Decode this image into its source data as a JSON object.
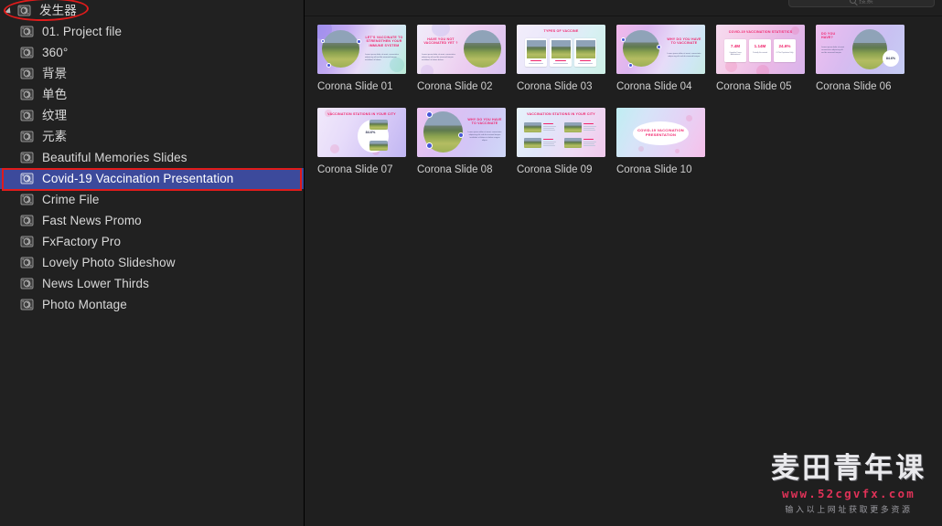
{
  "window": {
    "background": "#1f1f1f",
    "sidebar_background": "#212121",
    "selection_color": "#3c4a9c",
    "annotation_color": "#e01b1b"
  },
  "sidebar": {
    "group": {
      "label": "发生器",
      "icon": "generator-icon",
      "expanded": true
    },
    "items": [
      {
        "label": "01. Project file",
        "icon": "generator-icon",
        "selected": false
      },
      {
        "label": "360°",
        "icon": "generator-icon",
        "selected": false
      },
      {
        "label": "背景",
        "icon": "generator-icon",
        "selected": false
      },
      {
        "label": "单色",
        "icon": "generator-icon",
        "selected": false
      },
      {
        "label": "纹理",
        "icon": "generator-icon",
        "selected": false
      },
      {
        "label": "元素",
        "icon": "generator-icon",
        "selected": false
      },
      {
        "label": "Beautiful Memories Slides",
        "icon": "generator-icon",
        "selected": false
      },
      {
        "label": "Covid-19 Vaccination Presentation",
        "icon": "generator-icon",
        "selected": true
      },
      {
        "label": "Crime File",
        "icon": "generator-icon",
        "selected": false
      },
      {
        "label": "Fast News Promo",
        "icon": "generator-icon",
        "selected": false
      },
      {
        "label": "FxFactory Pro",
        "icon": "generator-icon",
        "selected": false
      },
      {
        "label": "Lovely Photo Slideshow",
        "icon": "generator-icon",
        "selected": false
      },
      {
        "label": "News Lower Thirds",
        "icon": "generator-icon",
        "selected": false
      },
      {
        "label": "Photo Montage",
        "icon": "generator-icon",
        "selected": false
      }
    ]
  },
  "search": {
    "placeholder": "搜索",
    "value": "",
    "icon": "search-icon"
  },
  "browser": {
    "items": [
      {
        "caption": "Corona Slide 01",
        "layout": "circle-left-text-right",
        "title": "LET'S VACCINATE TO STRENGTHEN YOUR IMMUNE SYSTEM",
        "body": "Lorem ipsum dolor sit amet, consectetur adipiscing elit sed do eiusmod tempor incididunt ut labore.",
        "bg": "linear-gradient(115deg,#a99cf0 0%,#c3aaf2 28%,#e8dcf7 55%,#cfe9f2 80%,#b9ead6 100%)"
      },
      {
        "caption": "Corona Slide 02",
        "layout": "text-left-circle-right",
        "title": "HAVE YOU NOT VACCINATED YET ?",
        "body": "Lorem ipsum dolor sit amet, consectetur adipiscing elit sed do eiusmod tempor incididunt ut labore dolore.",
        "bg": "linear-gradient(115deg,#f0ecfa 0%,#efdcf4 35%,#eccdf0 60%,#d8c3f1 100%)"
      },
      {
        "caption": "Corona Slide 03",
        "layout": "three-cards",
        "title": "TYPES OF VACCINE",
        "cards": [
          "Vaccine 01",
          "Vaccine 02",
          "Vaccine 03"
        ],
        "bg": "linear-gradient(115deg,#f3eefb 0%,#e9e6fb 40%,#d9f0f4 70%,#cdf0e6 100%)"
      },
      {
        "caption": "Corona Slide 04",
        "layout": "circle-left-text-right",
        "title": "WHY DO YOU HAVE TO VACCINATE",
        "body": "Lorem ipsum dolor sit amet, consectetur adipiscing elit sed do eiusmod tempor.",
        "bg": "linear-gradient(115deg,#f3b9ea 0%,#dcb6f0 30%,#e7dcf8 58%,#cfe7f5 82%,#c8eae3 100%)"
      },
      {
        "caption": "Corona Slide 05",
        "layout": "stats",
        "title": "COVID-19 VACCINATION STATISTICS",
        "stats": [
          {
            "value": "7.4M",
            "caption": "Complete Doses Administered"
          },
          {
            "value": "1.14M",
            "caption": "Partially Vaccinated"
          },
          {
            "value": "24.6%",
            "caption": "Of The Population Fully"
          }
        ],
        "bg": "linear-gradient(115deg,#f6dcef 0%,#f3c9e8 35%,#eab9e6 62%,#d9b4ec 100%)"
      },
      {
        "caption": "Corona Slide 06",
        "layout": "text-left-oval-right-badge",
        "title": "DO YOU HAVE?",
        "body": "Lorem ipsum dolor sit amet consectetur adipiscing elit sed do eiusmod tempor.",
        "badge": "84.6%",
        "bg": "linear-gradient(115deg,#efc0ef 0%,#d9bbf0 38%,#c9c0f2 68%,#c6cdf4 100%)"
      },
      {
        "caption": "Corona Slide 07",
        "layout": "blob-photos-right",
        "title": "VACCINATION STATIONS IN YOUR CITY",
        "badge": "84.6%",
        "bg": "linear-gradient(115deg,#f1e9fb 0%,#e7dcfa 35%,#d4c7f6 70%,#c0b6f3 100%)"
      },
      {
        "caption": "Corona Slide 08",
        "layout": "circle-left-text-right",
        "title": "WHY DO YOU HAVE TO VACCINATE",
        "body": "Lorem ipsum dolor sit amet, consectetur adipiscing elit sed do eiusmod tempor incididunt ut labore et dolore magna aliqua.",
        "bg": "linear-gradient(115deg,#eec6f1 0%,#ddc0f3 32%,#d2c6f6 62%,#cfd8f7 100%)"
      },
      {
        "caption": "Corona Slide 09",
        "layout": "four-cards",
        "title": "VACCINATION STATIONS IN YOUR CITY",
        "cards": [
          "Station 01",
          "Station 02",
          "Station 03",
          "Station 04"
        ],
        "bg": "linear-gradient(115deg,#e8f3fb 0%,#e0e6fa 35%,#eed9f3 70%,#f1c9ec 100%)"
      },
      {
        "caption": "Corona Slide 10",
        "layout": "title-oval",
        "title": "COVID-19 VACCINATION PRESENTATION",
        "bg": "linear-gradient(115deg,#bfeef2 0%,#d6e4f8 30%,#e2d6f7 58%,#f0c8ef 85%,#f5bfe9 100%)"
      }
    ]
  },
  "watermark": {
    "brand": "麦田青年课",
    "url": "www.52cgvfx.com",
    "subtitle": "输入以上网址获取更多资源"
  }
}
